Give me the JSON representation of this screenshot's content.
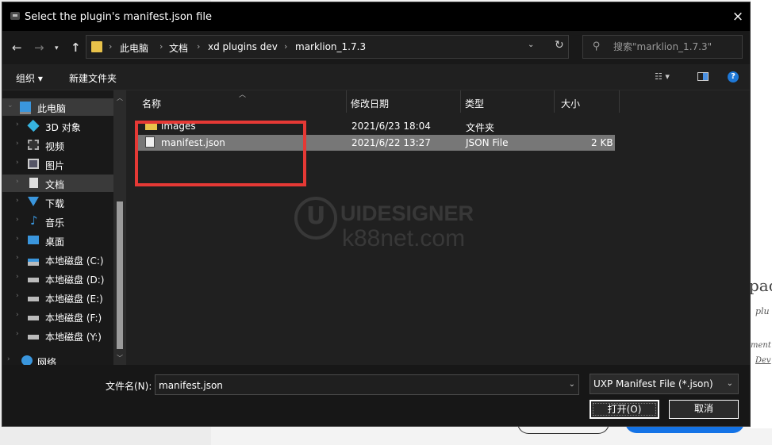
{
  "background": {
    "heading_fragment": "pac",
    "line1": "plu",
    "line2": "ment",
    "line3": "Dev"
  },
  "dialog": {
    "title": "Select the plugin's manifest.json file",
    "close_icon": "×"
  },
  "nav": {
    "back_icon": "←",
    "forward_icon": "→",
    "recent_icon": "▾",
    "up_icon": "↑"
  },
  "address": {
    "crumbs": [
      "此电脑",
      "文档",
      "xd plugins dev",
      "marklion_1.7.3"
    ],
    "separator": "›",
    "dropdown_icon": "⌄",
    "refresh_icon": "↻"
  },
  "search": {
    "placeholder": "搜索\"marklion_1.7.3\"",
    "icon": "⚲"
  },
  "toolbar": {
    "organize": "组织 ▾",
    "new_folder": "新建文件夹",
    "view": "☷ ▾",
    "help": "?"
  },
  "sidebar": {
    "items": [
      {
        "label": "此电脑",
        "icon": "computer-icon",
        "color": "#3a96dd"
      },
      {
        "label": "3D 对象",
        "icon": "cube-icon",
        "color": "#36b4e0"
      },
      {
        "label": "视频",
        "icon": "film-icon",
        "color": "#aaaaaa"
      },
      {
        "label": "图片",
        "icon": "picture-icon",
        "color": "#cccccc"
      },
      {
        "label": "文档",
        "icon": "document-icon",
        "color": "#dddddd"
      },
      {
        "label": "下载",
        "icon": "download-icon",
        "color": "#3a96dd"
      },
      {
        "label": "音乐",
        "icon": "music-icon",
        "color": "#3a96dd"
      },
      {
        "label": "桌面",
        "icon": "desktop-icon",
        "color": "#3a96dd"
      },
      {
        "label": "本地磁盘 (C:)",
        "icon": "drive-windows-icon",
        "color": "#cccccc"
      },
      {
        "label": "本地磁盘 (D:)",
        "icon": "drive-icon",
        "color": "#cccccc"
      },
      {
        "label": "本地磁盘 (E:)",
        "icon": "drive-icon",
        "color": "#cccccc"
      },
      {
        "label": "本地磁盘 (F:)",
        "icon": "drive-icon",
        "color": "#cccccc"
      },
      {
        "label": "本地磁盘 (Y:)",
        "icon": "drive-icon",
        "color": "#cccccc"
      },
      {
        "label": "网络",
        "icon": "network-icon",
        "color": "#3a96dd"
      }
    ],
    "chevron": "›",
    "expanded_chevron": "⌄",
    "scroll_up": "︿",
    "scroll_down": "﹀"
  },
  "columns": {
    "name": "名称",
    "date": "修改日期",
    "type": "类型",
    "size": "大小",
    "sort_icon": "︿"
  },
  "files": [
    {
      "name": "images",
      "date": "2021/6/23 18:04",
      "type": "文件夹",
      "size": "",
      "icon": "folder-icon"
    },
    {
      "name": "manifest.json",
      "date": "2021/6/22 13:27",
      "type": "JSON File",
      "size": "2 KB",
      "icon": "json-file-icon"
    }
  ],
  "watermark": {
    "logo_letter": "U",
    "line1": "UIDESIGNER",
    "line2": "k88net.com"
  },
  "bottom": {
    "filename_label": "文件名(N):",
    "filename_value": "manifest.json",
    "filetype_value": "UXP Manifest File (*.json)",
    "dropdown_icon": "⌄",
    "open_label": "打开(O)",
    "cancel_label": "取消"
  },
  "colors": {
    "highlight_box": "#e53935",
    "folder": "#e8c24a"
  }
}
